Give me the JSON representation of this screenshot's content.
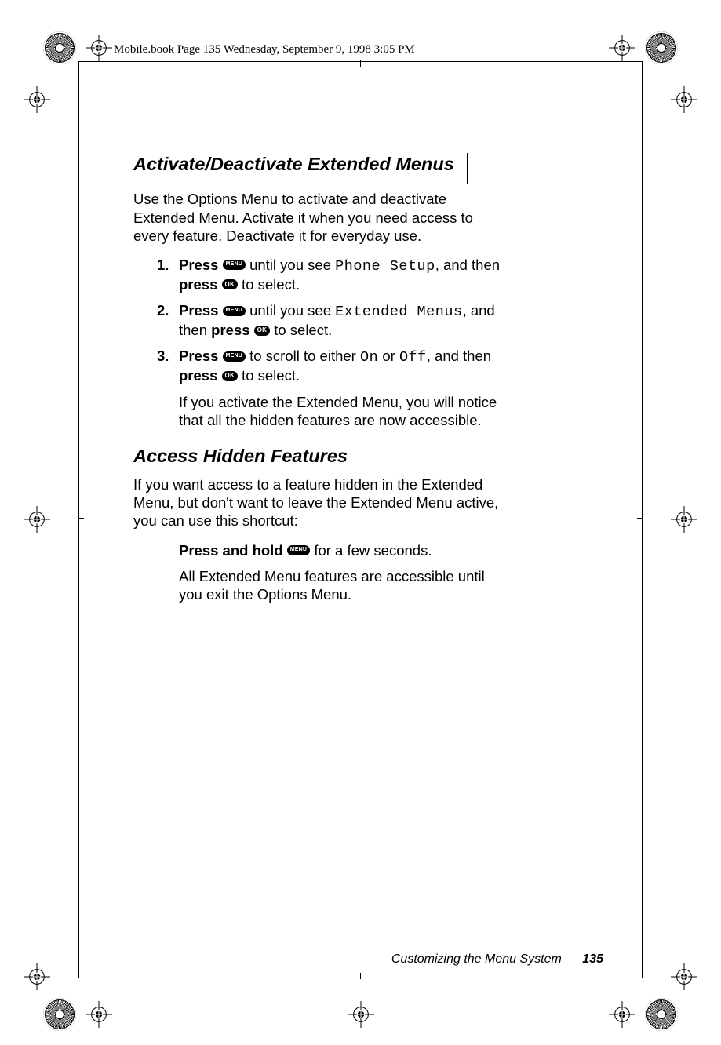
{
  "header": {
    "book_page_info": "Mobile.book  Page 135  Wednesday, September 9, 1998  3:05 PM"
  },
  "buttons": {
    "menu": "MENU",
    "ok": "OK"
  },
  "section1": {
    "heading": "Activate/Deactivate Extended Menus",
    "intro": "Use the Options Menu to activate and deactivate Extended Menu. Activate it when you need access to every feature. Deactivate it for everyday use.",
    "steps": [
      {
        "num": "1.",
        "pre": "Press",
        "mid1": " until you see ",
        "lcd": "Phone Setup",
        "mid2": ", and then ",
        "press2": "press",
        "tail": " to select."
      },
      {
        "num": "2.",
        "pre": "Press",
        "mid1": " until you see ",
        "lcd": "Extended Menus",
        "mid2": ", and then ",
        "press2": "press",
        "tail": " to select."
      },
      {
        "num": "3.",
        "pre": "Press",
        "mid1": " to scroll to either ",
        "lcd": "On",
        "mid_or": " or ",
        "lcd2": "Off",
        "mid2": ", and then ",
        "press2": "press",
        "tail": " to select."
      }
    ],
    "note": "If you activate the Extended Menu, you will notice that all the hidden features are now accessible."
  },
  "section2": {
    "heading": "Access Hidden Features",
    "intro": "If you want access to a feature hidden in the Extended Menu, but don't want to leave the Extended Menu active, you can use this shortcut:",
    "action_pre": "Press and hold",
    "action_tail": " for a few seconds.",
    "result": "All Extended Menu features are accessible until you exit the Options Menu."
  },
  "footer": {
    "chapter": "Customizing the Menu System",
    "page": "135"
  }
}
